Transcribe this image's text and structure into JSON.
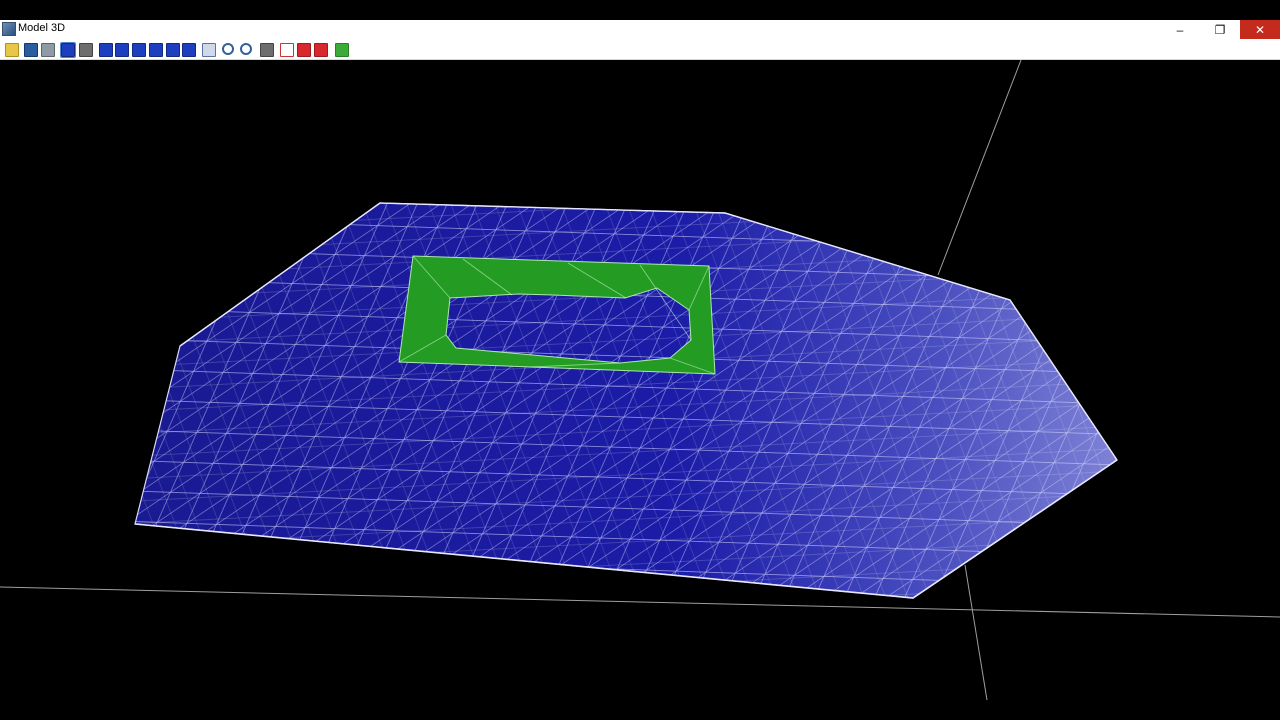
{
  "window": {
    "title": "Model 3D",
    "controls": {
      "minimize": "–",
      "restore": "❐",
      "close": "✕"
    }
  },
  "toolbar": {
    "buttons": [
      "open-icon",
      "save-icon",
      "print-icon",
      "rotate-icon",
      "pan-icon",
      "fit-left-icon",
      "fit-right-icon",
      "fit-top-icon",
      "fit-bottom-icon",
      "fit-horizontal-icon",
      "fit-vertical-icon",
      "zoom-window-icon",
      "zoom-in-icon",
      "zoom-out-icon",
      "axis-icon",
      "wireframe-icon",
      "solid-red-icon",
      "solid-icon",
      "refresh-icon"
    ]
  },
  "viewport": {
    "background": "#000000",
    "mesh_color": "#14148a",
    "wire_color": "#d9d9ff",
    "inner_region_color": "#249c24"
  }
}
